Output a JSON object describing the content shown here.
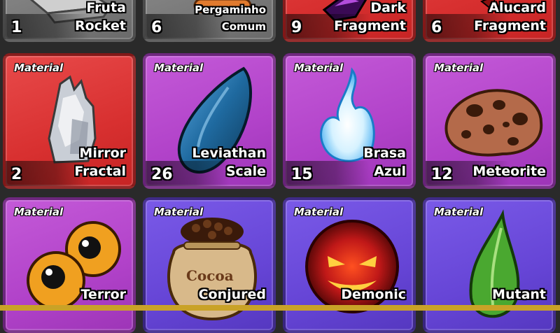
{
  "colors": {
    "red": "#d83030",
    "purple": "#b142c9",
    "violet": "#6645d6",
    "gray": "#7d7d7d",
    "bottom_bar": "#c9a227"
  },
  "row1": [
    {
      "name_line1": "Fruta",
      "name_line2": "Rocket",
      "count": "1",
      "rarity": "gray",
      "icon": "rocket-fruit-icon"
    },
    {
      "name_line1": "Pergaminho",
      "name_line2": "Comum",
      "count": "6",
      "rarity": "gray",
      "icon": "scroll-icon"
    },
    {
      "name_line1": "Dark",
      "name_line2": "Fragment",
      "count": "9",
      "rarity": "red",
      "icon": "dark-crystal-icon"
    },
    {
      "name_line1": "Alucard",
      "name_line2": "Fragment",
      "count": "6",
      "rarity": "red",
      "icon": "alucard-fragment-icon"
    }
  ],
  "row2": [
    {
      "tag": "Material",
      "name_line1": "Mirror",
      "name_line2": "Fractal",
      "count": "2",
      "rarity": "red",
      "icon": "mirror-shard-icon"
    },
    {
      "tag": "Material",
      "name_line1": "Leviathan",
      "name_line2": "Scale",
      "count": "26",
      "rarity": "purple",
      "icon": "scale-icon"
    },
    {
      "tag": "Material",
      "name_line1": "Brasa",
      "name_line2": "Azul",
      "count": "15",
      "rarity": "purple",
      "icon": "blue-flame-icon"
    },
    {
      "tag": "Material",
      "name_line1": "",
      "name_line2": "Meteorite",
      "count": "12",
      "rarity": "purple",
      "icon": "meteorite-icon"
    }
  ],
  "row3": [
    {
      "tag": "Material",
      "name_line1": "Terror",
      "rarity": "purple",
      "icon": "eyeballs-icon"
    },
    {
      "tag": "Material",
      "name_line1": "Conjured",
      "rarity": "violet",
      "icon": "cocoa-sack-icon",
      "sack_label": "Cocoa"
    },
    {
      "tag": "Material",
      "name_line1": "Demonic",
      "rarity": "violet",
      "icon": "demonic-orb-icon"
    },
    {
      "tag": "Material",
      "name_line1": "Mutant",
      "rarity": "violet",
      "icon": "mutant-leaf-icon"
    }
  ]
}
